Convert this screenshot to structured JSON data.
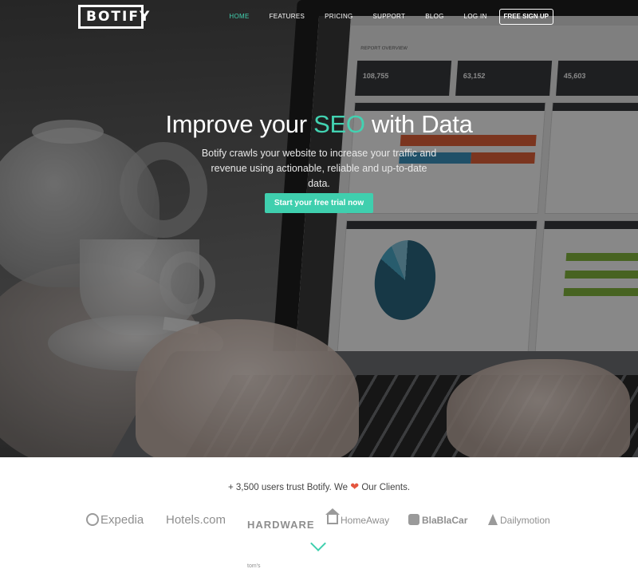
{
  "brand": {
    "logo_text": "BOTIFY"
  },
  "nav": {
    "items": [
      {
        "label": "HOME",
        "active": true
      },
      {
        "label": "FEATURES",
        "active": false
      },
      {
        "label": "PRICING",
        "active": false
      },
      {
        "label": "SUPPORT",
        "active": false
      },
      {
        "label": "BLOG",
        "active": false
      },
      {
        "label": "LOG IN",
        "active": false
      }
    ],
    "signup_label": "FREE SIGN UP"
  },
  "hero": {
    "title_prefix": "Improve your ",
    "title_accent": "SEO",
    "title_suffix": " with Data",
    "subtitle": "Botify crawls your website to increase your traffic and revenue using actionable, reliable and up-to-date data.",
    "cta_label": "Start your free trial now"
  },
  "dashboard": {
    "title": "REPORT OVERVIEW",
    "kpis": [
      "108,755",
      "63,152",
      "45,603"
    ]
  },
  "trust": {
    "prefix": "+ 3,500 users trust Botify. We ",
    "heart": "❤",
    "suffix": " Our Clients.",
    "clients": [
      "Expedia",
      "Hotels.com",
      "tom's",
      "HARDWARE",
      "HomeAway",
      "BlaBlaCar",
      "Dailymotion"
    ]
  },
  "colors": {
    "accent": "#42d2b1",
    "cta": "#3fcfae",
    "heart": "#e4563f"
  },
  "icons": {
    "scroll_down": "chevron-down-icon"
  }
}
